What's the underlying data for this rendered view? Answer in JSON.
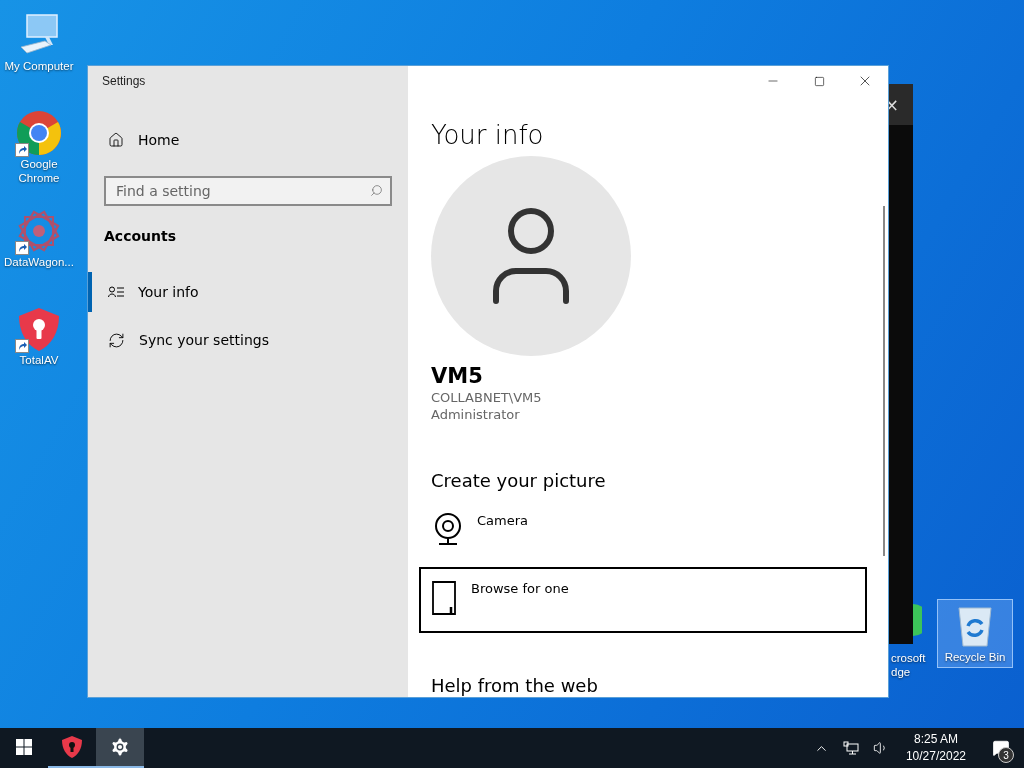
{
  "desktop_icons": [
    {
      "kind": "computer",
      "label": "My Computer",
      "shortcut": false,
      "selected": false
    },
    {
      "kind": "chrome",
      "label": "Google Chrome",
      "shortcut": true,
      "selected": false
    },
    {
      "kind": "datawagon",
      "label": "DataWagon...",
      "shortcut": true,
      "selected": false
    },
    {
      "kind": "totalav",
      "label": "TotalAV",
      "shortcut": true,
      "selected": false
    }
  ],
  "edge_icon": {
    "label_lines": [
      "crosoft",
      "dge"
    ]
  },
  "right_icons": [
    {
      "kind": "recycle",
      "label_lines": [
        "Recycle Bin"
      ],
      "selected": true
    }
  ],
  "back_window": {
    "close": "×"
  },
  "settings": {
    "title": "Settings",
    "home": "Home",
    "search": {
      "placeholder": "Find a setting"
    },
    "section": "Accounts",
    "nav": [
      {
        "kind": "info",
        "label": "Your info",
        "selected": true
      },
      {
        "kind": "sync",
        "label": "Sync your settings",
        "selected": false
      }
    ],
    "page_title": "Your info",
    "user": {
      "name": "VM5",
      "account": "COLLABNET\\VM5",
      "role": "Administrator"
    },
    "picture_heading": "Create your picture",
    "options": [
      {
        "kind": "camera",
        "label": "Camera",
        "focused": false
      },
      {
        "kind": "browse",
        "label": "Browse for one",
        "focused": true
      }
    ],
    "help_heading": "Help from the web"
  },
  "taskbar": {
    "apps": [
      {
        "kind": "totalav",
        "active": false
      },
      {
        "kind": "settings",
        "active": true
      }
    ],
    "time": "8:25 AM",
    "date": "10/27/2022",
    "notifications": "3"
  }
}
